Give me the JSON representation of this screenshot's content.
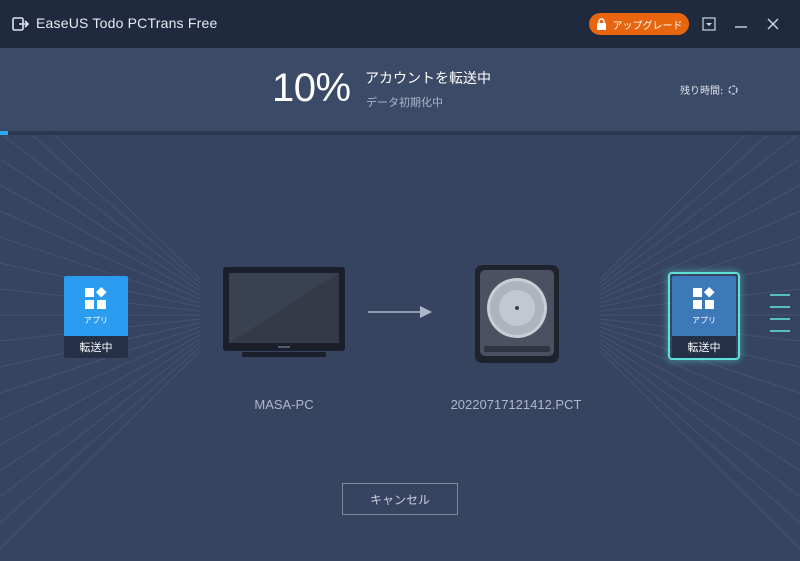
{
  "window": {
    "title": "EaseUS Todo PCTrans Free",
    "upgrade_label": "アップグレード"
  },
  "progress": {
    "percent_text": "10%",
    "percent_value": 10,
    "status": "アカウントを転送中",
    "substatus": "データ初期化中",
    "remaining_label": "残り時間:"
  },
  "transfer": {
    "source_tile": {
      "icon": "apps-grid-icon",
      "label": "アプリ",
      "status": "転送中"
    },
    "target_tile": {
      "icon": "apps-grid-icon",
      "label": "アプリ",
      "status": "転送中"
    },
    "source_name": "MASA-PC",
    "destination_name": "20220717121412.PCT"
  },
  "actions": {
    "cancel_label": "キャンセル"
  },
  "colors": {
    "accent": "#2ea7f5",
    "upgrade": "#e8650f",
    "highlight": "#5fe0d8"
  }
}
